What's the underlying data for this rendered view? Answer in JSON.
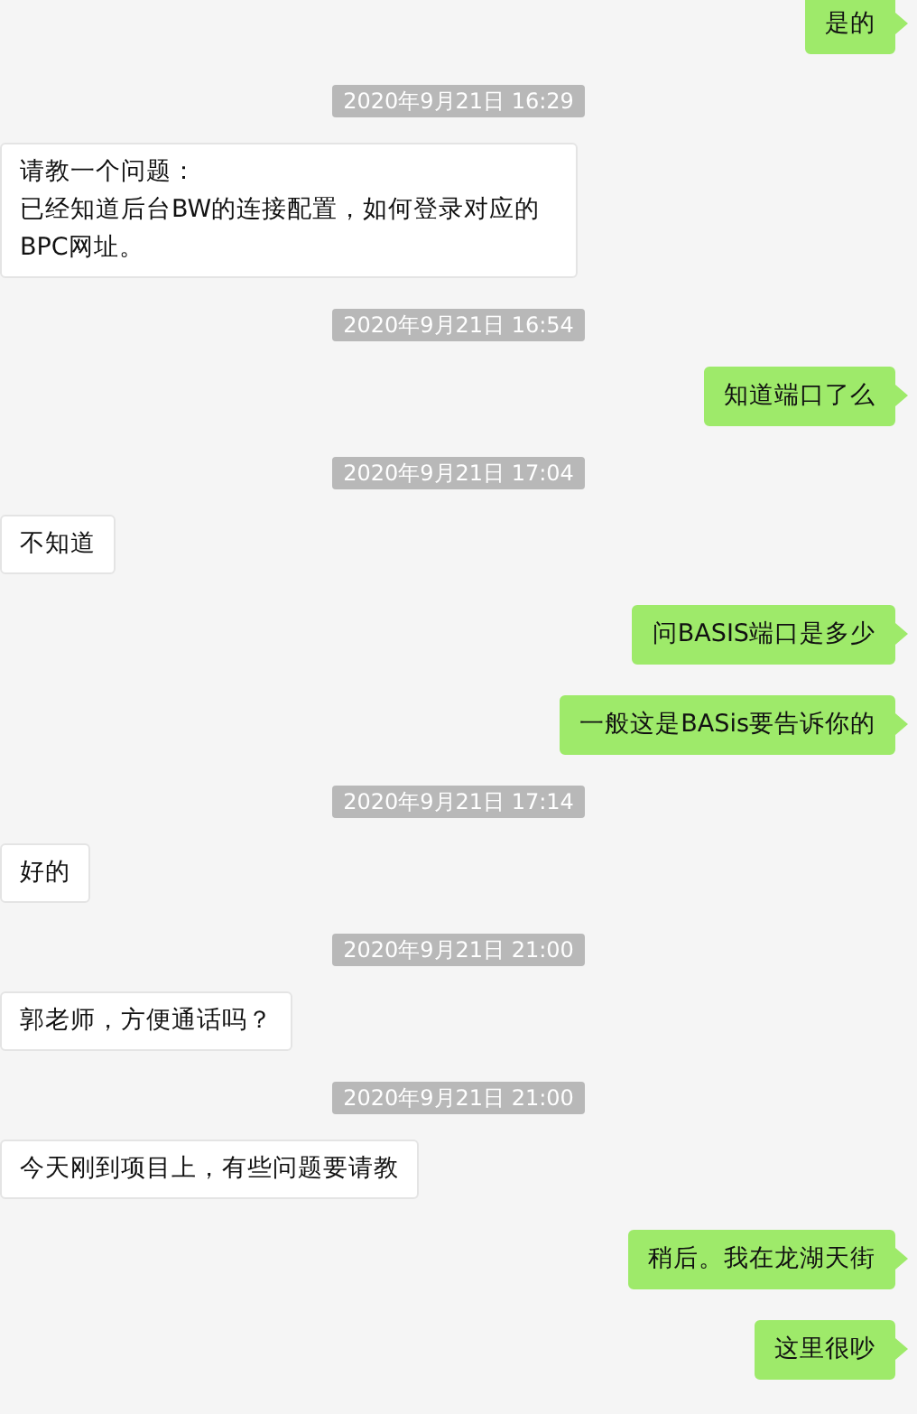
{
  "messages": [
    {
      "kind": "message",
      "sent": true,
      "text": "是的"
    },
    {
      "kind": "time",
      "text": "2020年9月21日 16:29"
    },
    {
      "kind": "message",
      "sent": false,
      "lines": [
        "请教一个问题：",
        "已经知道后台BW的连接配置，如何登录对应的BPC网址。"
      ]
    },
    {
      "kind": "time",
      "text": "2020年9月21日 16:54"
    },
    {
      "kind": "message",
      "sent": true,
      "text": "知道端口了么"
    },
    {
      "kind": "time",
      "text": "2020年9月21日 17:04"
    },
    {
      "kind": "message",
      "sent": false,
      "text": "不知道"
    },
    {
      "kind": "message",
      "sent": true,
      "text": "问BASIS端口是多少"
    },
    {
      "kind": "message",
      "sent": true,
      "text": "一般这是BASis要告诉你的"
    },
    {
      "kind": "time",
      "text": "2020年9月21日 17:14"
    },
    {
      "kind": "message",
      "sent": false,
      "text": "好的"
    },
    {
      "kind": "time",
      "text": "2020年9月21日 21:00"
    },
    {
      "kind": "message",
      "sent": false,
      "text": "郭老师，方便通话吗？"
    },
    {
      "kind": "time",
      "text": "2020年9月21日 21:00"
    },
    {
      "kind": "message",
      "sent": false,
      "text": "今天刚到项目上，有些问题要请教"
    },
    {
      "kind": "message",
      "sent": true,
      "text": "稍后。我在龙湖天街"
    },
    {
      "kind": "message",
      "sent": true,
      "text": "这里很吵"
    }
  ]
}
